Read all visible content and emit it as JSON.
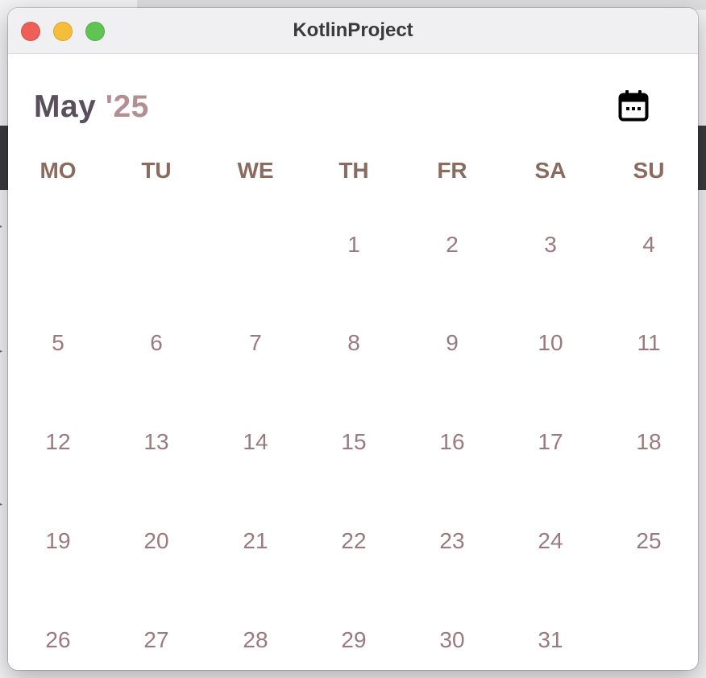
{
  "window": {
    "title": "KotlinProject"
  },
  "header": {
    "month": "May",
    "year": "'25",
    "calendar_icon": "calendar-icon"
  },
  "weekdays": [
    "MO",
    "TU",
    "WE",
    "TH",
    "FR",
    "SA",
    "SU"
  ],
  "days": [
    [
      "",
      "",
      "",
      "1",
      "2",
      "3",
      "4"
    ],
    [
      "5",
      "6",
      "7",
      "8",
      "9",
      "10",
      "11"
    ],
    [
      "12",
      "13",
      "14",
      "15",
      "16",
      "17",
      "18"
    ],
    [
      "19",
      "20",
      "21",
      "22",
      "23",
      "24",
      "25"
    ],
    [
      "26",
      "27",
      "28",
      "29",
      "30",
      "31",
      ""
    ]
  ],
  "colors": {
    "month": "#5a4f5c",
    "year": "#b58e92",
    "weekday": "#8a6b5d",
    "day": "#9a7a80",
    "traffic_close": "#ee5f58",
    "traffic_minimize": "#f6bd3b",
    "traffic_maximize": "#5fc454"
  }
}
